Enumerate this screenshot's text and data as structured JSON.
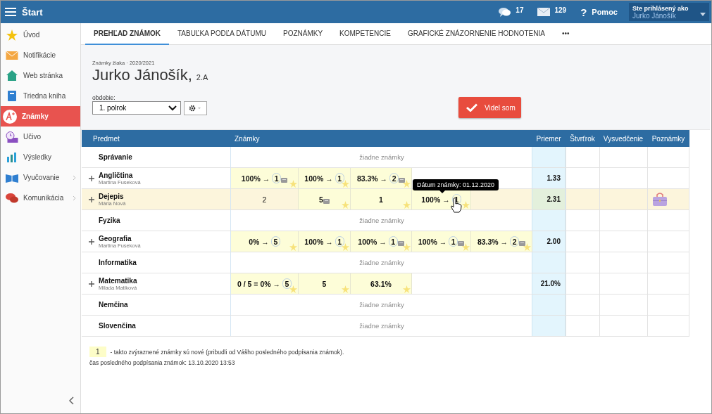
{
  "topbar": {
    "title": "Štart",
    "messages": "17",
    "mail": "129",
    "help_icon": "?",
    "help": "Pomoc",
    "user_label": "Ste prihlásený ako",
    "user_name": "Jurko Jánošík"
  },
  "sidebar": {
    "items": [
      {
        "label": "Úvod",
        "selected": false,
        "submenu": false
      },
      {
        "label": "Notifikácie",
        "selected": false,
        "submenu": false
      },
      {
        "label": "Web stránka",
        "selected": false,
        "submenu": false
      },
      {
        "label": "Triedna kniha",
        "selected": false,
        "submenu": false
      },
      {
        "label": "Známky",
        "selected": true,
        "submenu": false
      },
      {
        "label": "Učivo",
        "selected": false,
        "submenu": false
      },
      {
        "label": "Výsledky",
        "selected": false,
        "submenu": false
      },
      {
        "label": "Vyučovanie",
        "selected": false,
        "submenu": true
      },
      {
        "label": "Komunikácia",
        "selected": false,
        "submenu": true
      }
    ]
  },
  "tabs": [
    {
      "label": "PREHĽAD ZNÁMOK",
      "selected": true
    },
    {
      "label": "TABUĽKA PODĽA DÁTUMU",
      "selected": false
    },
    {
      "label": "POZNÁMKY",
      "selected": false
    },
    {
      "label": "KOMPETENCIE",
      "selected": false
    },
    {
      "label": "GRAFICKÉ ZNÁZORNENIE HODNOTENIA",
      "selected": false
    },
    {
      "label": "•••",
      "selected": false
    }
  ],
  "header": {
    "subtitle": "Známky žiaka · 2020/2021",
    "student": "Jurko Jánošík,",
    "class": "2.A",
    "period_label": "obdobie:",
    "period": "1. polrok",
    "confirm_button": "Videl som"
  },
  "table": {
    "columns": [
      "Predmet",
      "Známky",
      "Priemer",
      "Štvrťrok",
      "Vysvedčenie",
      "Poznámky"
    ],
    "rows": [
      {
        "subject": "Správanie",
        "expandable": false,
        "highlighted": false,
        "empty_text": "žiadne známky",
        "grades": [],
        "average": "",
        "note_icon": false
      },
      {
        "subject": "Angličtina",
        "teacher": "Martina Fuseková",
        "expandable": true,
        "highlighted": false,
        "grades": [
          {
            "value": "100% →",
            "mark": "1",
            "note": true,
            "new": true
          },
          {
            "value": "100% →",
            "mark": "1",
            "note": false,
            "new": true
          },
          {
            "value": "83.3% →",
            "mark": "2",
            "note": true,
            "new": true
          }
        ],
        "average": "1.33",
        "note_icon": false
      },
      {
        "subject": "Dejepis",
        "teacher": "Mária Nová",
        "expandable": true,
        "highlighted": true,
        "grades": [
          {
            "value": "2",
            "note": false,
            "new": false
          },
          {
            "value": "5",
            "note": true,
            "new": true
          },
          {
            "value": "1",
            "note": false,
            "new": true
          },
          {
            "value": "100% →",
            "mark": "1",
            "note": false,
            "new": true
          }
        ],
        "average": "2.31",
        "note_icon": true
      },
      {
        "subject": "Fyzika",
        "expandable": false,
        "highlighted": false,
        "empty_text": "žiadne známky",
        "grades": [],
        "average": "",
        "note_icon": false
      },
      {
        "subject": "Geografia",
        "teacher": "Martina Fuseková",
        "expandable": true,
        "highlighted": false,
        "grades": [
          {
            "value": "0% →",
            "mark": "5",
            "note": false,
            "new": true
          },
          {
            "value": "100% →",
            "mark": "1",
            "note": false,
            "new": true
          },
          {
            "value": "100% →",
            "mark": "1",
            "note": true,
            "new": true
          },
          {
            "value": "100% →",
            "mark": "1",
            "note": true,
            "new": true
          },
          {
            "value": "83.3% →",
            "mark": "2",
            "note": true,
            "new": true
          }
        ],
        "average": "2.00",
        "note_icon": false
      },
      {
        "subject": "Informatika",
        "expandable": false,
        "highlighted": false,
        "empty_text": "žiadne známky",
        "grades": [],
        "average": "",
        "note_icon": false
      },
      {
        "subject": "Matematika",
        "teacher": "Milada Matiková",
        "expandable": true,
        "highlighted": false,
        "grades": [
          {
            "value": "0 / 5 = 0% →",
            "mark": "5",
            "note": false,
            "new": true
          },
          {
            "value": "5",
            "note": false,
            "new": true
          },
          {
            "value": "63.1%",
            "note": false,
            "new": true
          }
        ],
        "average": "21.0%",
        "note_icon": false
      },
      {
        "subject": "Nemčina",
        "expandable": false,
        "highlighted": false,
        "empty_text": "žiadne známky",
        "grades": [],
        "average": "",
        "note_icon": false
      },
      {
        "subject": "Slovenčina",
        "expandable": false,
        "highlighted": false,
        "empty_text": "žiadne známky",
        "grades": [],
        "average": "",
        "note_icon": false
      }
    ]
  },
  "tooltip": {
    "text": "Dátum známky: 01.12.2020"
  },
  "footer": {
    "legend_mark": "1",
    "legend_text": "- takto zvýraznené známky sú nové (pribudli od Vášho posledného podpísania známok).",
    "signed": "čas posledného podpísania známok: 13.10.2020 13:53"
  }
}
